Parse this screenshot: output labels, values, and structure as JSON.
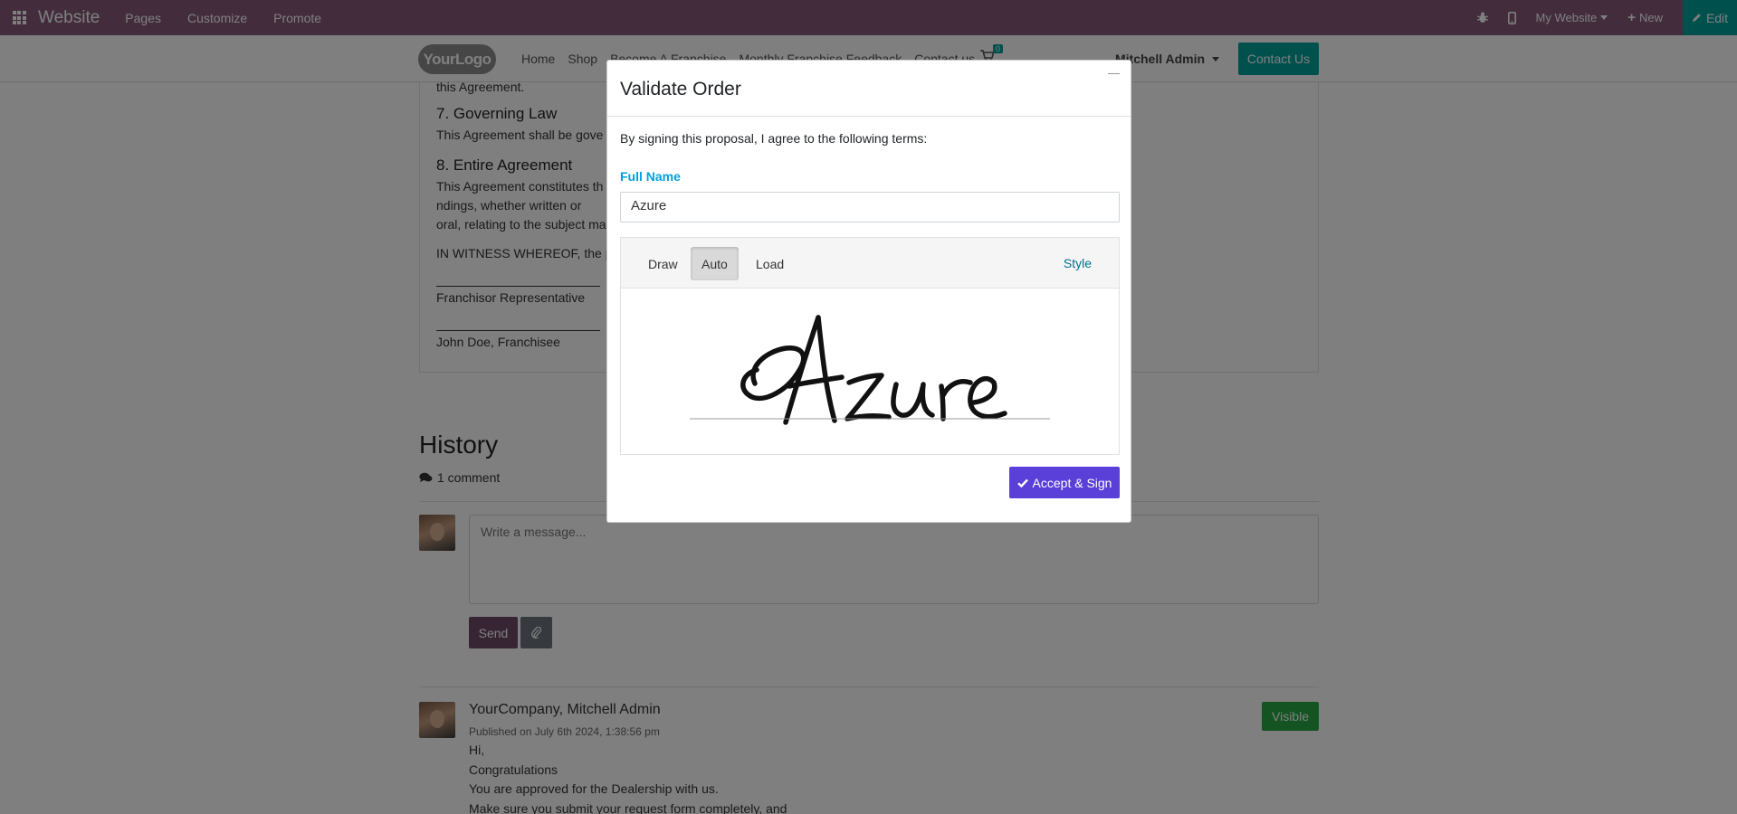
{
  "topbar": {
    "app_name": "Website",
    "menus": [
      "Pages",
      "Customize",
      "Promote"
    ],
    "website_selector": "My Website",
    "new_label": "New",
    "edit_label": "Edit"
  },
  "sitenav": {
    "logo_text": "YourLogo",
    "links": [
      "Home",
      "Shop",
      "Become A Franchise",
      "Monthly Franchise Feedback",
      "Contact us"
    ],
    "cart_count": "0",
    "user": "Mitchell Admin",
    "contact_label": "Contact Us"
  },
  "document": {
    "tail_line": "this Agreement.",
    "s7_title": "7. Governing Law",
    "s7_text": "This Agreement shall be gove",
    "s8_title": "8. Entire Agreement",
    "s8_text_a": "This Agreement constitutes th",
    "s8_text_b": "ndings, whether written or",
    "s8_text_c": "oral, relating to the subject ma",
    "witness": "IN WITNESS WHEREOF, the pa",
    "signer1": "Franchisor Representative",
    "signer2": "John Doe, Franchisee"
  },
  "history": {
    "title": "History",
    "comment_count": "1 comment",
    "message_placeholder": "Write a message...",
    "send_label": "Send",
    "post": {
      "author": "YourCompany, Mitchell Admin",
      "date": "Published on July 6th 2024, 1:38:56 pm",
      "visible_label": "Visible",
      "lines": [
        "Hi,",
        "Congratulations",
        "You are approved for the Dealership with us.",
        "Make sure you submit your request form completely, and"
      ]
    }
  },
  "modal": {
    "title": "Validate Order",
    "close_glyph": "—",
    "intro": "By signing this proposal, I agree to the following terms:",
    "full_name_label": "Full Name",
    "full_name_value": "Azure",
    "tabs": [
      "Draw",
      "Auto",
      "Load"
    ],
    "active_tab": "Auto",
    "style_label": "Style",
    "accept_label": "Accept & Sign"
  },
  "colors": {
    "topbar": "#875a7b",
    "teal": "#00a09d",
    "accept": "#5a3fd9",
    "label_blue": "#00a0dd"
  }
}
